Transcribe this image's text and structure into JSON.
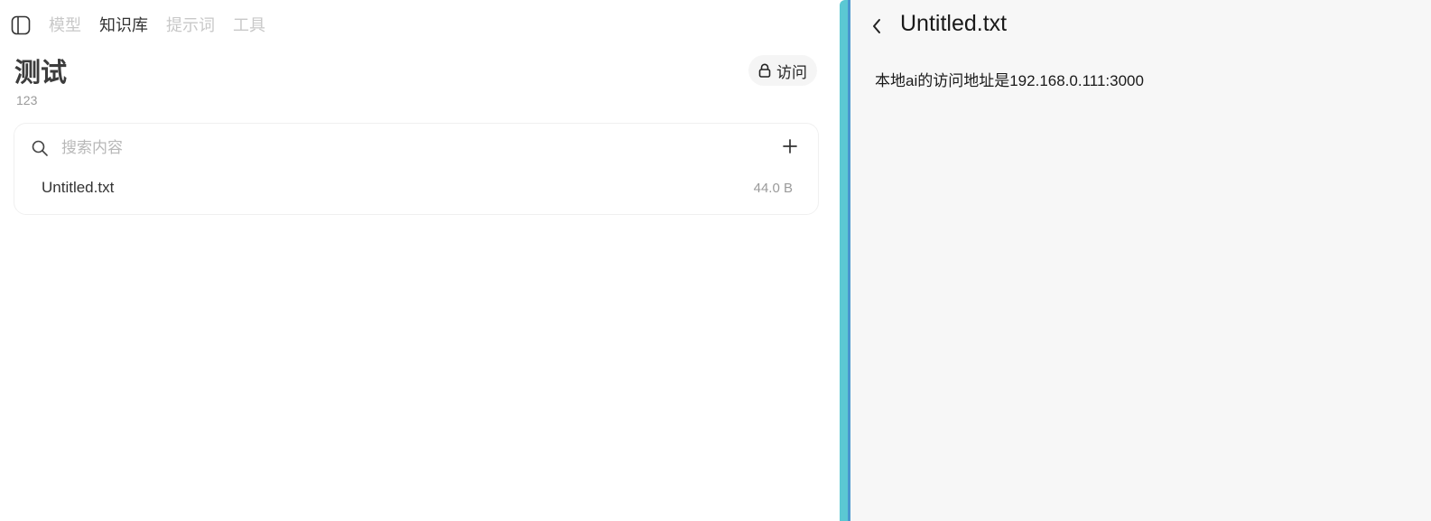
{
  "nav": {
    "tabs": [
      {
        "label": "模型",
        "active": false
      },
      {
        "label": "知识库",
        "active": true
      },
      {
        "label": "提示词",
        "active": false
      },
      {
        "label": "工具",
        "active": false
      }
    ]
  },
  "knowledge_base": {
    "title": "测试",
    "description": "123",
    "access_button_label": "访问"
  },
  "search": {
    "placeholder": "搜索内容",
    "value": ""
  },
  "files": [
    {
      "name": "Untitled.txt",
      "size": "44.0 B"
    }
  ],
  "preview": {
    "title": "Untitled.txt",
    "content": "本地ai的访问地址是192.168.0.111:3000"
  },
  "colors": {
    "divider": "#5bc8d3",
    "divider_edge": "#4a97cf",
    "preview_background": "#f7f7f7",
    "inactive_tab": "#c8c8c8"
  },
  "icons": {
    "sidebar_toggle": "sidebar-toggle-icon",
    "lock": "lock-icon",
    "search": "search-icon",
    "add": "plus-icon",
    "back": "chevron-left-icon"
  }
}
